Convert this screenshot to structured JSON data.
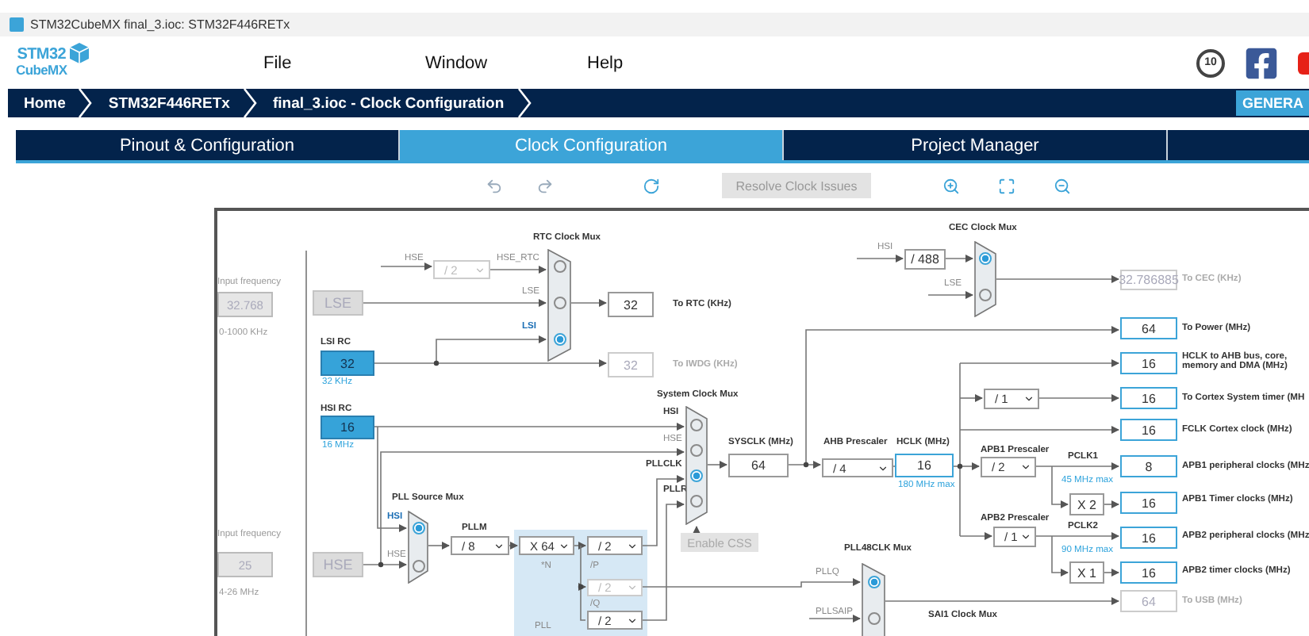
{
  "window": {
    "title": "STM32CubeMX final_3.ioc: STM32F446RETx"
  },
  "logo": {
    "line1": "STM32",
    "line2": "CubeMX"
  },
  "menu": [
    "File",
    "Window",
    "Help"
  ],
  "badge": "10",
  "breadcrumb": [
    "Home",
    "STM32F446RETx",
    "final_3.ioc - Clock Configuration"
  ],
  "generate_button": "GENERA",
  "tabs": [
    {
      "label": "Pinout & Configuration",
      "selected": false
    },
    {
      "label": "Clock Configuration",
      "selected": true
    },
    {
      "label": "Project Manager",
      "selected": false
    }
  ],
  "toolbar": {
    "resolve_button": {
      "label": "Resolve Clock Issues",
      "disabled": true
    }
  },
  "diagram": {
    "labels": [
      {
        "text": "Input frequency",
        "kind": "caption"
      },
      {
        "text": "0-1000 KHz",
        "kind": "caption"
      },
      {
        "text": "RTC Clock Mux",
        "kind": "title"
      },
      {
        "text": "HSE",
        "kind": "signal"
      },
      {
        "text": "HSE_RTC",
        "kind": "signal"
      },
      {
        "text": "LSE",
        "kind": "signal"
      },
      {
        "text": "LSI",
        "kind": "active"
      },
      {
        "text": "To RTC (KHz)",
        "kind": "output"
      },
      {
        "text": "LSI RC",
        "kind": "title"
      },
      {
        "text": "32 KHz",
        "kind": "note"
      },
      {
        "text": "To IWDG (KHz)",
        "kind": "muted"
      },
      {
        "text": "HSI RC",
        "kind": "title"
      },
      {
        "text": "16 MHz",
        "kind": "note"
      },
      {
        "text": "System Clock Mux",
        "kind": "title"
      },
      {
        "text": "HSI",
        "kind": "strong"
      },
      {
        "text": "HSE",
        "kind": "signal"
      },
      {
        "text": "PLLCLK",
        "kind": "strong"
      },
      {
        "text": "PLLR",
        "kind": "strong"
      },
      {
        "text": "SYSCLK (MHz)",
        "kind": "title"
      },
      {
        "text": "AHB Prescaler",
        "kind": "title"
      },
      {
        "text": "HCLK (MHz)",
        "kind": "title"
      },
      {
        "text": "180 MHz max",
        "kind": "note"
      },
      {
        "text": "CEC Clock Mux",
        "kind": "title"
      },
      {
        "text": "HSI",
        "kind": "signal"
      },
      {
        "text": "LSE",
        "kind": "signal"
      },
      {
        "text": "To CEC (KHz)",
        "kind": "muted"
      },
      {
        "text": "To Power (MHz)",
        "kind": "output"
      },
      {
        "text": "HCLK to AHB bus, core, memory and DMA (MHz)",
        "kind": "output"
      },
      {
        "text": "To Cortex System timer (MH",
        "kind": "output"
      },
      {
        "text": "FCLK Cortex clock (MHz)",
        "kind": "output"
      },
      {
        "text": "APB1 Prescaler",
        "kind": "title"
      },
      {
        "text": "PCLK1",
        "kind": "title"
      },
      {
        "text": "45 MHz max",
        "kind": "note"
      },
      {
        "text": "APB1 peripheral clocks (MHz",
        "kind": "output"
      },
      {
        "text": "APB1 Timer clocks (MHz)",
        "kind": "output"
      },
      {
        "text": "APB2 Prescaler",
        "kind": "title"
      },
      {
        "text": "PCLK2",
        "kind": "title"
      },
      {
        "text": "90 MHz max",
        "kind": "note"
      },
      {
        "text": "APB2 peripheral clocks (MHz",
        "kind": "output"
      },
      {
        "text": "APB2 timer clocks (MHz)",
        "kind": "output"
      },
      {
        "text": "To USB (MHz)",
        "kind": "muted"
      },
      {
        "text": "PLL48CLK Mux",
        "kind": "title"
      },
      {
        "text": "PLLQ",
        "kind": "signal"
      },
      {
        "text": "PLLSAIP",
        "kind": "signal"
      },
      {
        "text": "SAI1 Clock Mux",
        "kind": "title"
      },
      {
        "text": "Input frequency",
        "kind": "caption"
      },
      {
        "text": "4-26 MHz",
        "kind": "caption"
      },
      {
        "text": "PLL Source Mux",
        "kind": "title"
      },
      {
        "text": "HSI",
        "kind": "active"
      },
      {
        "text": "HSE",
        "kind": "signal"
      },
      {
        "text": "PLLM",
        "kind": "title"
      },
      {
        "text": "*N",
        "kind": "signal"
      },
      {
        "text": "/P",
        "kind": "signal"
      },
      {
        "text": "/Q",
        "kind": "signal"
      },
      {
        "text": "PLL",
        "kind": "signal"
      }
    ],
    "boxes": [
      {
        "value": "32.768",
        "kind": "input",
        "disabled": true
      },
      {
        "value": "LSE",
        "kind": "oscillator",
        "disabled": true
      },
      {
        "value": "32",
        "kind": "value",
        "disabled": false
      },
      {
        "value": "32",
        "kind": "source",
        "disabled": false
      },
      {
        "value": "32",
        "kind": "value",
        "disabled": true
      },
      {
        "value": "16",
        "kind": "source",
        "disabled": false
      },
      {
        "value": "64",
        "kind": "value",
        "disabled": false
      },
      {
        "value": "16",
        "kind": "result",
        "disabled": false
      },
      {
        "value": "/ 488",
        "kind": "value",
        "disabled": false
      },
      {
        "value": "32.786885",
        "kind": "value",
        "disabled": true
      },
      {
        "value": "64",
        "kind": "result",
        "disabled": false
      },
      {
        "value": "16",
        "kind": "result",
        "disabled": false
      },
      {
        "value": "16",
        "kind": "result",
        "disabled": false
      },
      {
        "value": "16",
        "kind": "result",
        "disabled": false
      },
      {
        "value": "8",
        "kind": "result",
        "disabled": false
      },
      {
        "value": "X 2",
        "kind": "value",
        "disabled": false
      },
      {
        "value": "16",
        "kind": "result",
        "disabled": false
      },
      {
        "value": "16",
        "kind": "result",
        "disabled": false
      },
      {
        "value": "X 1",
        "kind": "value",
        "disabled": false
      },
      {
        "value": "16",
        "kind": "result",
        "disabled": false
      },
      {
        "value": "64",
        "kind": "value",
        "disabled": true
      },
      {
        "value": "25",
        "kind": "input",
        "disabled": true
      },
      {
        "value": "HSE",
        "kind": "oscillator",
        "disabled": true
      }
    ],
    "dropdowns": [
      {
        "value": "/ 2",
        "disabled": true
      },
      {
        "value": "/ 4",
        "disabled": false
      },
      {
        "value": "/ 1",
        "disabled": false
      },
      {
        "value": "/ 2",
        "disabled": false
      },
      {
        "value": "/ 1",
        "disabled": false
      },
      {
        "value": "/ 8",
        "disabled": false
      },
      {
        "value": "X 64",
        "disabled": false
      },
      {
        "value": "/ 2",
        "disabled": false
      },
      {
        "value": "/ 2",
        "disabled": true
      },
      {
        "value": "/ 2",
        "disabled": false
      }
    ],
    "muxes": [
      {
        "options": [
          {
            "selected": false
          },
          {
            "selected": false
          },
          {
            "selected": true
          }
        ]
      },
      {
        "options": [
          {
            "selected": false
          },
          {
            "selected": false
          },
          {
            "selected": true
          },
          {
            "selected": false
          }
        ]
      },
      {
        "options": [
          {
            "selected": true
          },
          {
            "selected": false
          }
        ]
      },
      {
        "options": [
          {
            "selected": true
          },
          {
            "selected": false
          }
        ]
      },
      {
        "options": [
          {
            "selected": true
          },
          {
            "selected": false
          }
        ]
      }
    ],
    "css_button": {
      "label": "Enable CSS",
      "disabled": true
    }
  }
}
